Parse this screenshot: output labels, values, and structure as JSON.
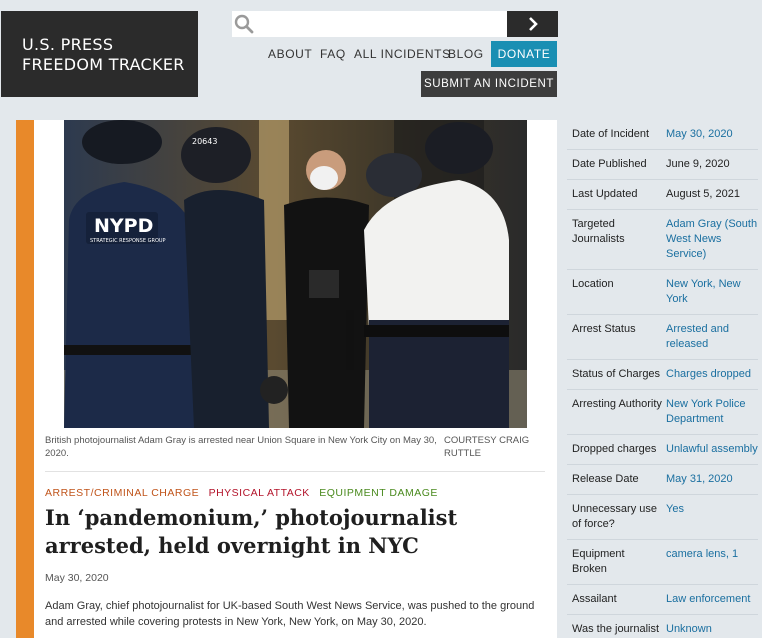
{
  "header": {
    "logo_line1": "U.S. PRESS",
    "logo_line2": "FREEDOM TRACKER",
    "search": {
      "placeholder": "",
      "value": ""
    },
    "nav": [
      "ABOUT",
      "FAQ",
      "ALL INCIDENTS",
      "BLOG"
    ],
    "donate_label": "DONATE",
    "submit_label": "SUBMIT AN INCIDENT"
  },
  "article": {
    "photo_text": {
      "nypd": "NYPD",
      "nypd_sub": "STRATEGIC RESPONSE GROUP",
      "helmet_number": "20643"
    },
    "caption": "British photojournalist Adam Gray is arrested near Union Square in New York City on May 30, 2020.",
    "credit": "COURTESY CRAIG RUTTLE",
    "tags": [
      {
        "label": "ARREST/CRIMINAL CHARGE",
        "color": "#c0541a"
      },
      {
        "label": "PHYSICAL ATTACK",
        "color": "#b3142b"
      },
      {
        "label": "EQUIPMENT DAMAGE",
        "color": "#4a8a1e"
      }
    ],
    "headline": "In ‘pandemonium,’ photojournalist arrested, held overnight in NYC",
    "date": "May 30, 2020",
    "summary": "Adam Gray, chief photojournalist for UK-based South West News Service, was pushed to the ground and arrested while covering protests in New York, New York, on May 30, 2020."
  },
  "sidebar": [
    {
      "label": "Date of Incident",
      "value": "May 30, 2020",
      "link": true
    },
    {
      "label": "Date Published",
      "value": "June 9, 2020",
      "link": false
    },
    {
      "label": "Last Updated",
      "value": "August 5, 2021",
      "link": false
    },
    {
      "label": "Targeted Journalists",
      "value": "Adam Gray (South West News Service)",
      "link": true
    },
    {
      "label": "Location",
      "value": "New York, New York",
      "link": true
    },
    {
      "label": "Arrest Status",
      "value": "Arrested and released",
      "link": true
    },
    {
      "label": "Status of Charges",
      "value": "Charges dropped",
      "link": true
    },
    {
      "label": "Arresting Authority",
      "value": "New York Police Department",
      "link": true
    },
    {
      "label": "Dropped charges",
      "value": "Unlawful assembly",
      "link": true
    },
    {
      "label": "Release Date",
      "value": "May 31, 2020",
      "link": true
    },
    {
      "label": "Unnecessary use of force?",
      "value": "Yes",
      "link": true
    },
    {
      "label": "Equipment Broken",
      "value": "camera lens, 1",
      "link": true
    },
    {
      "label": "Assailant",
      "value": "Law enforcement",
      "link": true
    },
    {
      "label": "Was the journalist",
      "value": "Unknown",
      "link": true
    }
  ],
  "colors": {
    "page_bg": "#e3e8ec",
    "accent_stripe": "#e8892a",
    "donate": "#1a8fb3",
    "link": "#1a6fa0"
  },
  "icons": {
    "search": "search-icon",
    "submit_search": "chevron-right-icon"
  }
}
